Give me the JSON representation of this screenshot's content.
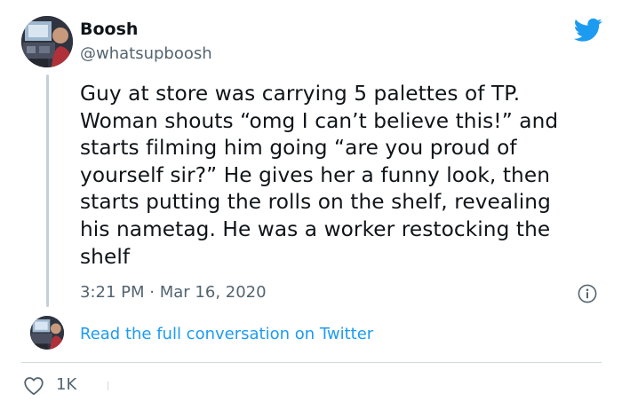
{
  "author": {
    "display_name": "Boosh",
    "handle": "@whatsupboosh"
  },
  "tweet": {
    "text": "Guy at store was carrying 5 palettes of TP.\nWoman shouts “omg I can’t believe this!” and\nstarts filming him going “are you proud of\nyourself sir?” He gives her a funny look, then\nstarts putting the rolls on the shelf, revealing\nhis nametag. He was a worker restocking the\nshelf",
    "time": "3:21 PM",
    "separator": "·",
    "date": "Mar 16, 2020"
  },
  "conversation_link": "Read the full conversation on Twitter",
  "engagement": {
    "likes": "1K"
  },
  "icons": {
    "brand": "twitter-bird-icon",
    "info": "info-icon",
    "like": "heart-icon"
  },
  "colors": {
    "brand_blue": "#1d9bf0",
    "text_primary": "#0f1419",
    "text_secondary": "#536471",
    "border": "#cfd9de"
  }
}
